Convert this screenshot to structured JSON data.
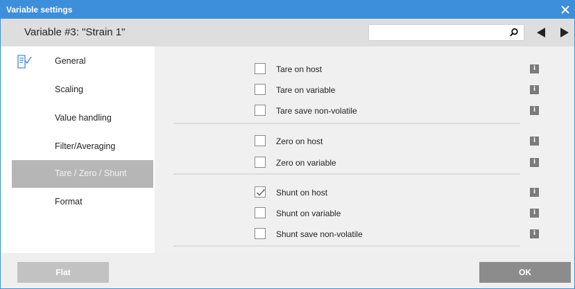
{
  "window": {
    "title": "Variable settings",
    "close_icon": "close-icon"
  },
  "header": {
    "variable_title": "Variable #3: \"Strain 1\"",
    "search": {
      "value": "",
      "placeholder": ""
    },
    "icons": {
      "search": "search-icon",
      "prev": "arrow-left-icon",
      "next": "arrow-right-icon"
    }
  },
  "sidebar": {
    "icon": "document-check-icon",
    "items": [
      {
        "label": "General",
        "active": false
      },
      {
        "label": "Scaling",
        "active": false
      },
      {
        "label": "Value handling",
        "active": false
      },
      {
        "label": "Filter/Averaging",
        "active": false
      },
      {
        "label": "Tare / Zero / Shunt",
        "active": true
      },
      {
        "label": "Format",
        "active": false
      }
    ]
  },
  "options": {
    "tare": [
      {
        "label": "Tare on host",
        "checked": false
      },
      {
        "label": "Tare on variable",
        "checked": false
      },
      {
        "label": "Tare save non-volatile",
        "checked": false
      }
    ],
    "zero": [
      {
        "label": "Zero on host",
        "checked": false
      },
      {
        "label": "Zero on variable",
        "checked": false
      }
    ],
    "shunt": [
      {
        "label": "Shunt on host",
        "checked": true
      },
      {
        "label": "Shunt on variable",
        "checked": false
      },
      {
        "label": "Shunt save non-volatile",
        "checked": false
      }
    ],
    "info_glyph": "i"
  },
  "footer": {
    "flat_label": "Flat",
    "ok_label": "OK"
  },
  "colors": {
    "titlebar": "#3d8fdc",
    "active_sidebar": "#b6b6b6",
    "ok_button": "#8c8c8c",
    "flat_button": "#c2c2c2"
  }
}
